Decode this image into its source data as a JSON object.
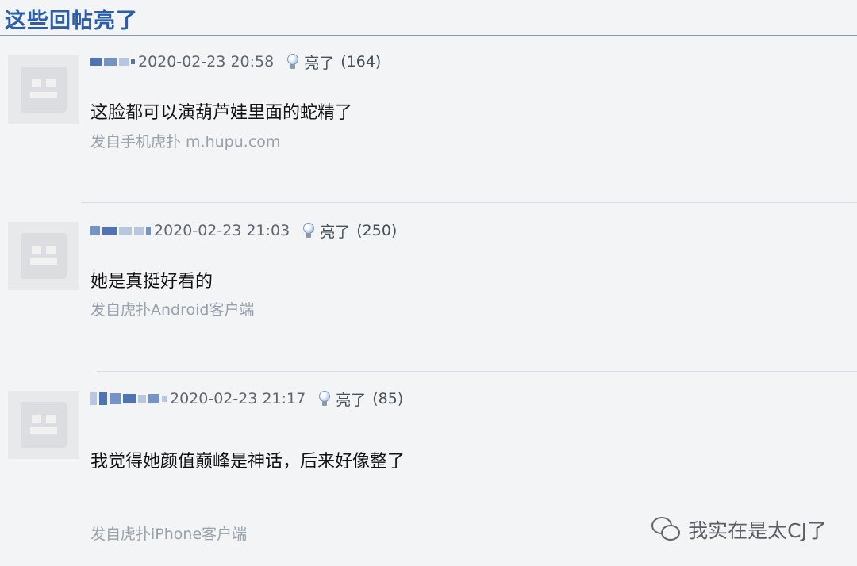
{
  "header": {
    "title": "这些回帖亮了"
  },
  "posts": [
    {
      "date": "2020-02-23 20:58",
      "light_label": "亮了",
      "light_count": "(164)",
      "content": "这脸都可以演葫芦娃里面的蛇精了",
      "source": "发自手机虎扑 m.hupu.com"
    },
    {
      "date": "2020-02-23 21:03",
      "light_label": "亮了",
      "light_count": "(250)",
      "content": "她是真挺好看的",
      "source": "发自虎扑Android客户端"
    },
    {
      "date": "2020-02-23 21:17",
      "light_label": "亮了",
      "light_count": "(85)",
      "content": "我觉得她颜值巅峰是神话，后来好像整了",
      "source": "发自虎扑iPhone客户端"
    }
  ],
  "watermark": {
    "text": "我实在是太CJ了"
  },
  "colors": {
    "title_blue": "#2a5ea9",
    "background": "#f3f4f6",
    "meta_gray": "#5f6670"
  }
}
